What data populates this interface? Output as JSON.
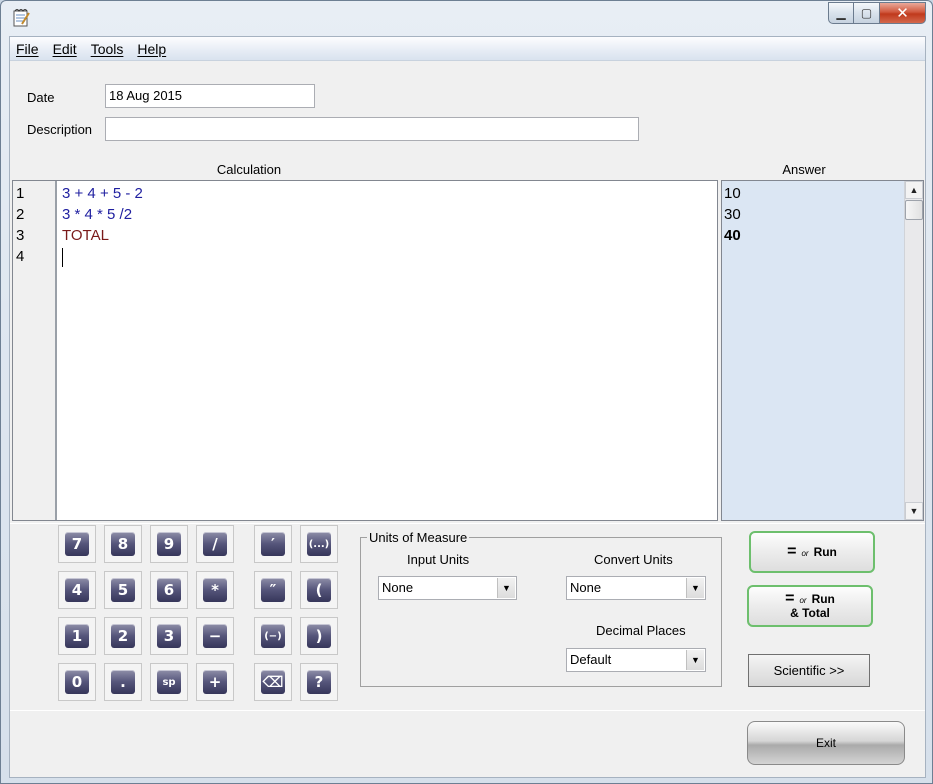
{
  "menu": [
    "File",
    "Edit",
    "Tools",
    "Help"
  ],
  "form": {
    "date_label": "Date",
    "date_value": "18 Aug 2015",
    "description_label": "Description",
    "description_value": ""
  },
  "headers": {
    "calculation": "Calculation",
    "answer": "Answer"
  },
  "lines": [
    {
      "no": "1",
      "text": "3 + 4 + 5 - 2",
      "color": "#1f1fa0"
    },
    {
      "no": "2",
      "text": "3 * 4 * 5 /2",
      "color": "#1f1fa0"
    },
    {
      "no": "3",
      "text": "TOTAL",
      "color": "#7a1a1a"
    },
    {
      "no": "4",
      "text": "",
      "color": "#000000"
    }
  ],
  "answers": [
    {
      "text": "10",
      "bold": false
    },
    {
      "text": "30",
      "bold": false
    },
    {
      "text": "40",
      "bold": true
    }
  ],
  "keypad": [
    [
      "7",
      "8",
      "9",
      "/",
      "′",
      "(...)"
    ],
    [
      "4",
      "5",
      "6",
      "*",
      "″",
      "("
    ],
    [
      "1",
      "2",
      "3",
      "−",
      "(−)",
      ")"
    ],
    [
      "0",
      ".",
      "sp",
      "+",
      "⌫",
      "?"
    ]
  ],
  "uom": {
    "legend": "Units of Measure",
    "input_label": "Input Units",
    "input_value": "None",
    "convert_label": "Convert Units",
    "convert_value": "None",
    "decimal_label": "Decimal Places",
    "decimal_value": "Default"
  },
  "buttons": {
    "run_or": "or",
    "run": "Run",
    "run_total_line1": "Run",
    "run_total_line2": "& Total",
    "scientific": "Scientific >>",
    "exit": "Exit"
  }
}
